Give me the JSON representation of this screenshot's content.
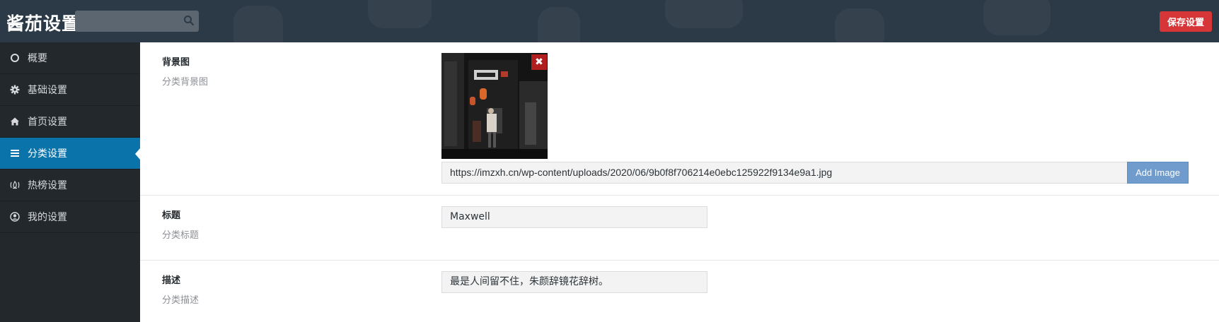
{
  "header": {
    "title": "酱茄设置",
    "search_placeholder": "",
    "save_label": "保存设置"
  },
  "sidebar": {
    "items": [
      {
        "label": "概要",
        "icon": "circle-icon"
      },
      {
        "label": "基础设置",
        "icon": "gear-icon"
      },
      {
        "label": "首页设置",
        "icon": "home-icon"
      },
      {
        "label": "分类设置",
        "icon": "list-icon",
        "active": true
      },
      {
        "label": "热榜设置",
        "icon": "fire-icon"
      },
      {
        "label": "我的设置",
        "icon": "user-circle-icon"
      }
    ]
  },
  "fields": {
    "background": {
      "label": "背景图",
      "desc": "分类背景图",
      "url": "https://imzxh.cn/wp-content/uploads/2020/06/9b0f8f706214e0ebc125922f9134e9a1.jpg",
      "add_label": "Add Image",
      "remove_symbol": "✖"
    },
    "title": {
      "label": "标题",
      "desc": "分类标题",
      "value": "Maxwell"
    },
    "description": {
      "label": "描述",
      "desc": "分类描述",
      "value": "最是人间留不住，朱颜辞镜花辞树。"
    }
  },
  "colors": {
    "header_bg": "#2c3a47",
    "sidebar_bg": "#23282d",
    "active_bg": "#0a73aa",
    "save_button": "#d63638",
    "add_image_button": "#6f9ccd"
  }
}
